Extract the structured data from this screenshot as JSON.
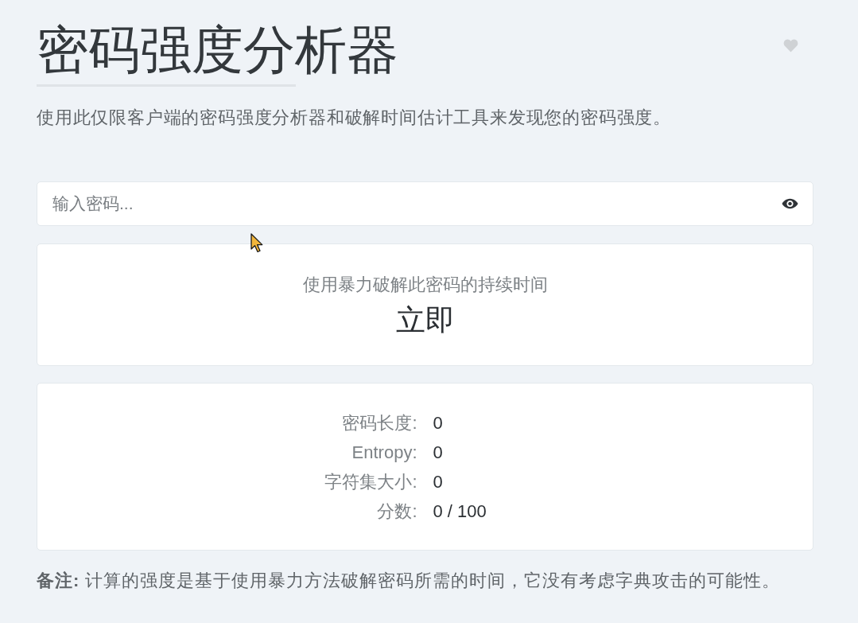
{
  "header": {
    "title": "密码强度分析器",
    "description": "使用此仅限客户端的密码强度分析器和破解时间估计工具来发现您的密码强度。"
  },
  "password_field": {
    "placeholder": "输入密码..."
  },
  "crack_time": {
    "label": "使用暴力破解此密码的持续时间",
    "value": "立即"
  },
  "stats": [
    {
      "label": "密码长度:",
      "value": "0"
    },
    {
      "label": "Entropy:",
      "value": "0"
    },
    {
      "label": "字符集大小:",
      "value": "0"
    },
    {
      "label": "分数:",
      "value": "0 / 100"
    }
  ],
  "note": "**备注:** 计算的强度是基于使用暴力方法破解密码所需的时间，它没有考虑字典攻击的可能性。"
}
